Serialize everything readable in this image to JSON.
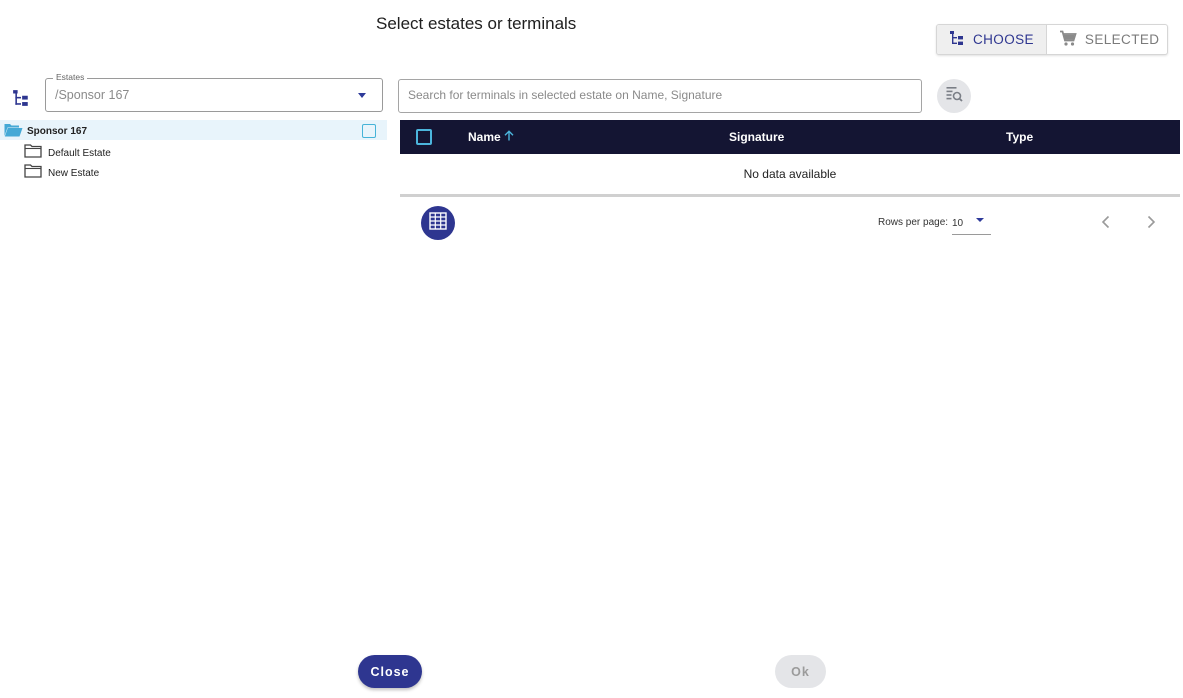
{
  "dialog": {
    "title": "Select estates or terminals"
  },
  "view_toggle": {
    "choose_label": "CHOOSE",
    "choose_icon": "tree-icon",
    "selected_label": "SELECTED",
    "selected_icon": "cart-icon",
    "active": "CHOOSE"
  },
  "estates": {
    "label": "Estates",
    "value": "/Sponsor 167"
  },
  "tree": {
    "root": {
      "label": "Sponsor 167",
      "icon": "folder-open-icon",
      "checked": false
    },
    "children": [
      {
        "label": "Default Estate",
        "icon": "folder-icon"
      },
      {
        "label": "New Estate",
        "icon": "folder-icon"
      }
    ]
  },
  "search": {
    "placeholder": "Search for terminals in selected estate on Name, Signature",
    "value": ""
  },
  "table": {
    "columns": [
      "Name",
      "Signature",
      "Type"
    ],
    "sorted_column": "Name",
    "sort_direction": "ascending",
    "empty_text": "No data available",
    "rows": []
  },
  "pagination": {
    "rows_per_page_label": "Rows per page:",
    "rows_per_page": "10"
  },
  "footer": {
    "close_label": "Close",
    "ok_label": "Ok"
  },
  "colors": {
    "primary": "#2e3690",
    "table_header": "#141533",
    "accent_checkbox": "#45b3d8",
    "selected_row": "#e8f4fb"
  }
}
